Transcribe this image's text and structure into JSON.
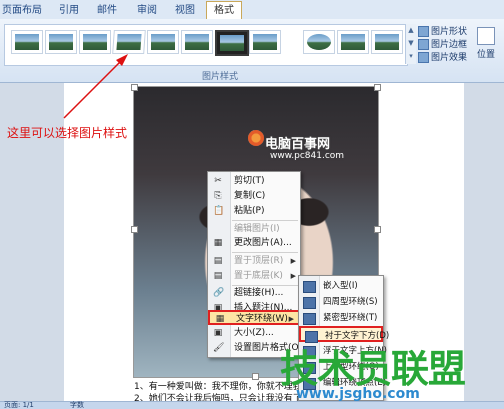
{
  "ribbon": {
    "tabs": [
      {
        "label": "页面布局",
        "active": false
      },
      {
        "label": "引用",
        "active": false
      },
      {
        "label": "邮件",
        "active": false
      },
      {
        "label": "审阅",
        "active": false
      },
      {
        "label": "视图",
        "active": false
      },
      {
        "label": "格式",
        "active": true
      }
    ],
    "group_label": "图片样式",
    "commands": {
      "shape": "图片形状",
      "border": "图片边框",
      "effect": "图片效果",
      "position": "位置"
    }
  },
  "annotation": {
    "text": "这里可以选择图片样式",
    "color": "#dd1111"
  },
  "watermark": {
    "site": "电脑百事网",
    "site_url": "www.pc841.com",
    "brand": "技术员联盟",
    "brand_url": "www.jsgho.com",
    "brand_color": "#28a838",
    "url_color": "#2d8acf"
  },
  "document": {
    "lines": [
      "1、有一种爱叫做：我不理你，你就不理我",
      "2、她们不会让我后悔吗，只会让我没有了信心"
    ]
  },
  "context_menu": {
    "items": [
      {
        "label": "剪切(T)",
        "icon": "✂",
        "disabled": false
      },
      {
        "label": "复制(C)",
        "icon": "⎘",
        "disabled": false
      },
      {
        "label": "粘贴(P)",
        "icon": "📋",
        "disabled": false
      },
      {
        "label": "编辑图片(I)",
        "icon": "",
        "disabled": true
      },
      {
        "label": "更改图片(A)...",
        "icon": "▦",
        "disabled": false
      },
      {
        "label": "置于顶层(R)",
        "icon": "▤",
        "disabled": true,
        "submenu": true
      },
      {
        "label": "置于底层(K)",
        "icon": "▤",
        "disabled": true,
        "submenu": true
      },
      {
        "label": "超链接(H)...",
        "icon": "🔗",
        "disabled": false
      },
      {
        "label": "插入题注(N)...",
        "icon": "▣",
        "disabled": false
      },
      {
        "label": "文字环绕(W)",
        "icon": "▦",
        "disabled": false,
        "submenu": true,
        "highlighted": true
      },
      {
        "label": "大小(Z)...",
        "icon": "▣",
        "disabled": false
      },
      {
        "label": "设置图片格式(O)...",
        "icon": "🖌",
        "disabled": false
      }
    ]
  },
  "wrap_submenu": {
    "items": [
      {
        "label": "嵌入型(I)",
        "highlighted": false
      },
      {
        "label": "四周型环绕(S)",
        "highlighted": false
      },
      {
        "label": "紧密型环绕(T)",
        "highlighted": false
      },
      {
        "label": "衬于文字下方(D)",
        "highlighted": true
      },
      {
        "label": "浮于文字上方(N)",
        "highlighted": false
      },
      {
        "label": "上下型环绕(O)",
        "highlighted": false
      },
      {
        "label": "编辑环绕顶点(E)",
        "highlighted": false
      }
    ]
  },
  "statusbar": {
    "left": "页面: 1/1",
    "words": "字数"
  }
}
